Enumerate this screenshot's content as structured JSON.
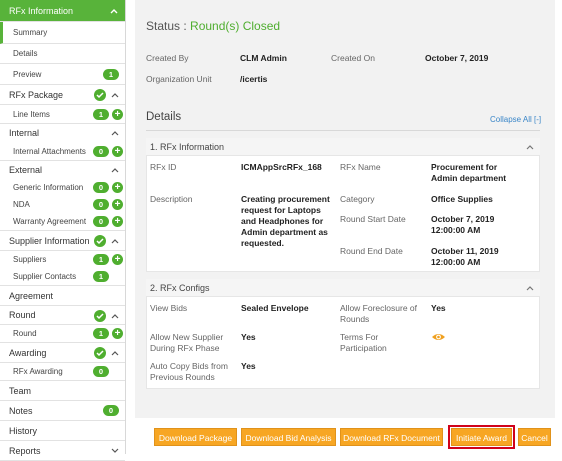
{
  "sidebar": {
    "rfx_information": "RFx Information",
    "summary": "Summary",
    "details": "Details",
    "preview": "Preview",
    "preview_count": "1",
    "rfx_package": "RFx Package",
    "line_items": "Line Items",
    "line_items_count": "1",
    "internal": "Internal",
    "internal_attachments": "Internal Attachments",
    "internal_attachments_count": "0",
    "external": "External",
    "generic_information": "Generic Information",
    "generic_information_count": "0",
    "nda": "NDA",
    "nda_count": "0",
    "warranty_agreement": "Warranty Agreement",
    "warranty_agreement_count": "0",
    "supplier_information": "Supplier Information",
    "suppliers": "Suppliers",
    "suppliers_count": "1",
    "supplier_contacts": "Supplier Contacts",
    "supplier_contacts_count": "1",
    "agreement": "Agreement",
    "round": "Round",
    "round_sub": "Round",
    "round_count": "1",
    "awarding": "Awarding",
    "rfx_awarding": "RFx Awarding",
    "rfx_awarding_count": "0",
    "team": "Team",
    "notes": "Notes",
    "notes_count": "0",
    "history": "History",
    "reports": "Reports"
  },
  "header": {
    "status_label": "Status :",
    "status_value": "Round(s) Closed",
    "created_by_label": "Created By",
    "created_by_value": "CLM Admin",
    "created_on_label": "Created On",
    "created_on_value": "October 7, 2019",
    "org_unit_label": "Organization Unit",
    "org_unit_value": "/icertis"
  },
  "details": {
    "title": "Details",
    "collapse_all": "Collapse All [-]"
  },
  "rfx_info": {
    "title": "1. RFx Information",
    "rfx_id_label": "RFx ID",
    "rfx_id_value": "ICMAppSrcRFx_168",
    "rfx_name_label": "RFx Name",
    "rfx_name_value_1": "Procurement for",
    "rfx_name_value_2": "Admin department",
    "description_label": "Description",
    "description_1": "Creating procurement",
    "description_2": "request for Laptops",
    "description_3": "and Headphones for",
    "description_4": "Admin department as",
    "description_5": "requested.",
    "category_label": "Category",
    "category_value": "Office Supplies",
    "round_start_label": "Round Start Date",
    "round_start_1": "October 7, 2019",
    "round_start_2": "12:00:00 AM",
    "round_end_label": "Round End Date",
    "round_end_1": "October 11, 2019",
    "round_end_2": "12:00:00 AM"
  },
  "rfx_configs": {
    "title": "2. RFx Configs",
    "view_bids_label": "View Bids",
    "view_bids_value": "Sealed Envelope",
    "allow_foreclosure_label_1": "Allow Foreclosure of",
    "allow_foreclosure_label_2": "Rounds",
    "allow_foreclosure_value": "Yes",
    "allow_new_supplier_label_1": "Allow New Supplier",
    "allow_new_supplier_label_2": "During RFx Phase",
    "allow_new_supplier_value": "Yes",
    "terms_label_1": "Terms For",
    "terms_label_2": "Participation",
    "auto_copy_label_1": "Auto Copy Bids from",
    "auto_copy_label_2": "Previous Rounds",
    "auto_copy_value": "Yes"
  },
  "actions": {
    "download_package": "Download Package",
    "download_bid_analysis": "Download Bid Analysis",
    "download_rfx_document": "Download RFx Document",
    "initiate_award": "Initiate Award",
    "cancel": "Cancel"
  },
  "colors": {
    "accent_green": "#58b33a",
    "status_green": "#4fae2f",
    "button_orange": "#f7a623",
    "highlight_red": "#d0021b"
  }
}
